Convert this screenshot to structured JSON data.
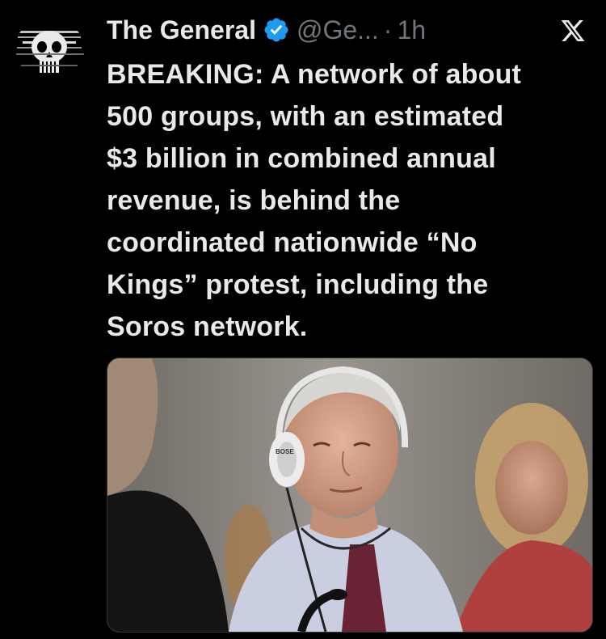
{
  "tweet": {
    "display_name": "The General",
    "handle": "@Ge...",
    "separator": "·",
    "time": "1h",
    "text": "BREAKING: A network of about\n500 groups, with an estimated\n$3 billion in combined annual\nrevenue, is behind the\ncoordinated nationwide “No\nKings” protest, including the\nSoros network."
  },
  "icons": {
    "verified": "verified-badge-icon",
    "platform": "x-logo-icon",
    "avatar": "skull-emblem-avatar"
  },
  "colors": {
    "background": "#000000",
    "text": "#e7e9ea",
    "muted": "#71767b",
    "verified": "#1d9bf0"
  },
  "photo": {
    "headphone_brand": "BOSE"
  }
}
